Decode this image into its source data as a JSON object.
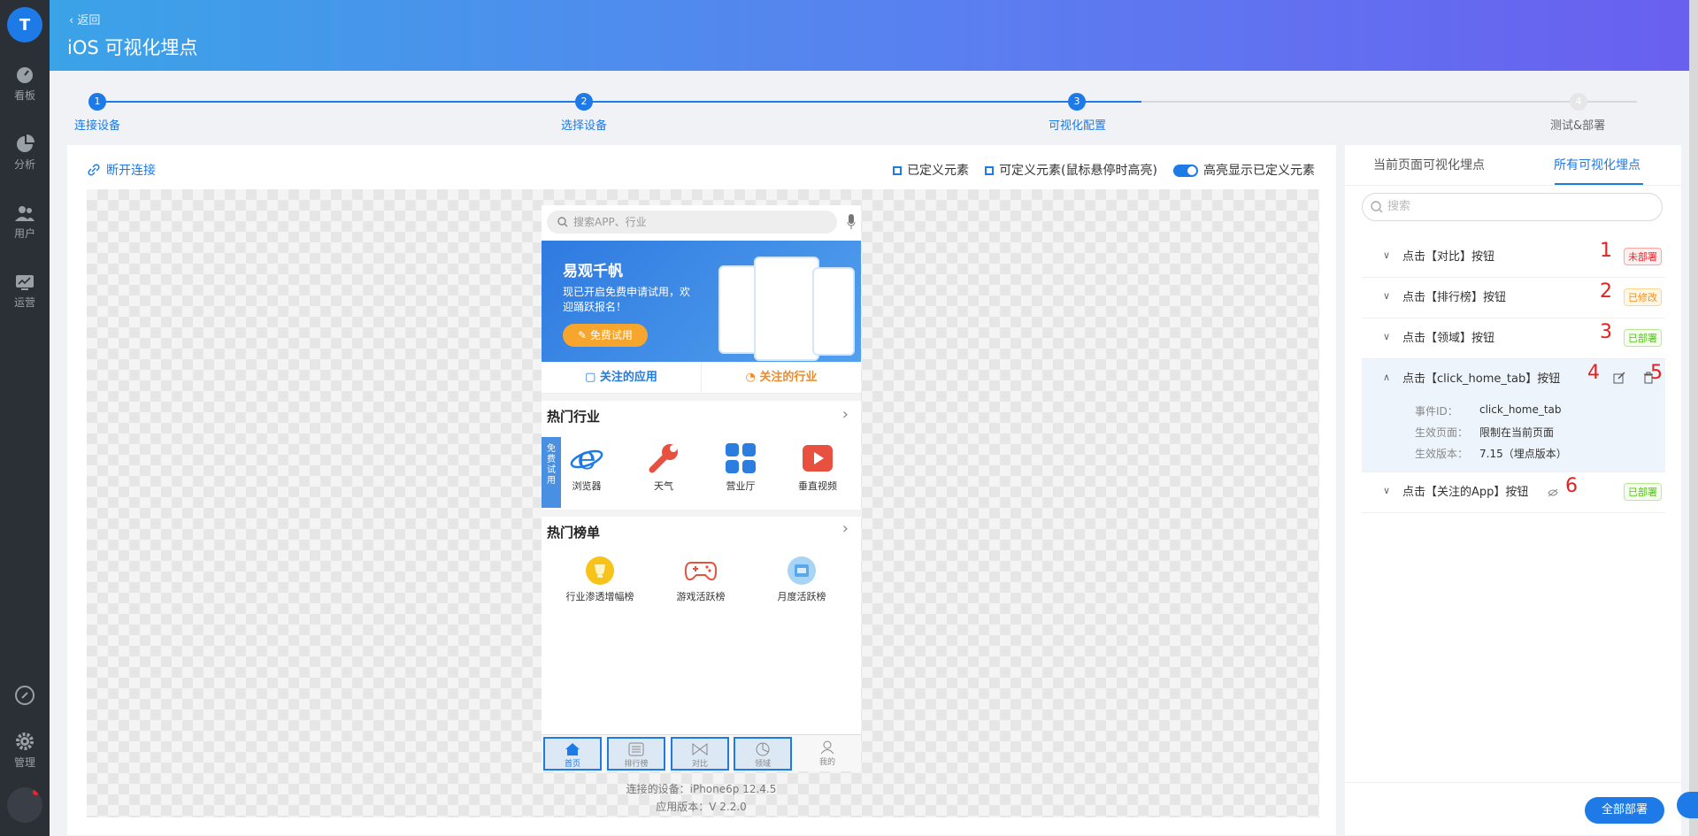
{
  "nav": {
    "logo": "T",
    "items": [
      "看板",
      "分析",
      "用户",
      "运营",
      "",
      "管理"
    ]
  },
  "header": {
    "back": "返回",
    "title": "iOS 可视化埋点"
  },
  "steps": [
    {
      "n": "1",
      "label": "连接设备"
    },
    {
      "n": "2",
      "label": "选择设备"
    },
    {
      "n": "3",
      "label": "可视化配置"
    },
    {
      "n": "4",
      "label": "测试&部署"
    }
  ],
  "toolbar": {
    "disconnect": "断开连接",
    "legend_defined": "已定义元素",
    "legend_definable": "可定义元素(鼠标悬停时高亮)",
    "legend_toggle": "高亮显示已定义元素"
  },
  "phone": {
    "search_placeholder": "搜索APP、行业",
    "banner_title": "易观千帆",
    "banner_sub": "现已开启免费申请试用，欢迎踊跃报名！",
    "banner_btn": "免费试用",
    "tab_apps": "关注的应用",
    "tab_industry": "关注的行业",
    "hot_industry": "热门行业",
    "free_tag": "免费试用",
    "industry": [
      "浏览器",
      "天气",
      "营业厅",
      "垂直视频"
    ],
    "hot_rank": "热门榜单",
    "ranks": [
      "行业渗透增幅榜",
      "游戏活跃榜",
      "月度活跃榜"
    ],
    "tabbar": [
      "首页",
      "排行榜",
      "对比",
      "领域",
      "我的"
    ]
  },
  "device": {
    "connected_label": "连接的设备：",
    "connected": "iPhone6p 12.4.5",
    "version_label": "应用版本：",
    "version": "V 2.2.0"
  },
  "right": {
    "tab_current": "当前页面可视化埋点",
    "tab_all": "所有可视化埋点",
    "search_placeholder": "搜索",
    "items": [
      {
        "label": "点击【对比】按钮",
        "num": "1",
        "status": "未部署"
      },
      {
        "label": "点击【排行榜】按钮",
        "num": "2",
        "status": "已修改"
      },
      {
        "label": "点击【领域】按钮",
        "num": "3",
        "status": "已部署"
      },
      {
        "label": "点击【click_home_tab】按钮",
        "num": "4",
        "num2": "5"
      },
      {
        "label": "点击【关注的App】按钮",
        "num": "6",
        "status": "已部署"
      }
    ],
    "detail": {
      "k1": "事件ID：",
      "v1": "click_home_tab",
      "k2": "生效页面：",
      "v2": "限制在当前页面",
      "k3": "生效版本：",
      "v3": "7.15（埋点版本）"
    },
    "deploy_all": "全部部署"
  },
  "colors": {
    "primary": "#1e7ae6",
    "danger": "#f5222d",
    "warning": "#fa8c16",
    "success": "#52c41a",
    "number": "#e5211f"
  }
}
